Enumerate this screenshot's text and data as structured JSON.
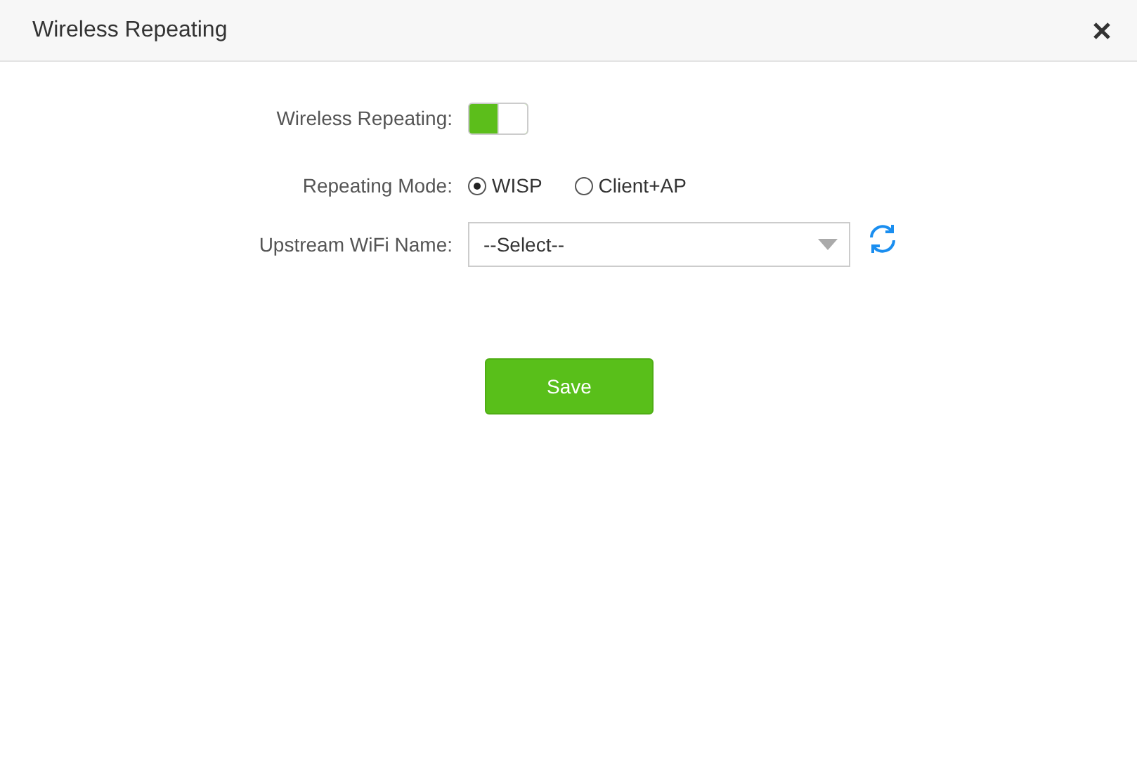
{
  "window": {
    "title": "Wireless Repeating"
  },
  "form": {
    "repeating": {
      "label": "Wireless Repeating:",
      "on": true
    },
    "mode": {
      "label": "Repeating Mode:",
      "options": [
        {
          "label": "WISP",
          "selected": true
        },
        {
          "label": "Client+AP",
          "selected": false
        }
      ]
    },
    "upstream": {
      "label": "Upstream WiFi Name:",
      "value": "--Select--"
    }
  },
  "buttons": [
    "Save"
  ]
}
